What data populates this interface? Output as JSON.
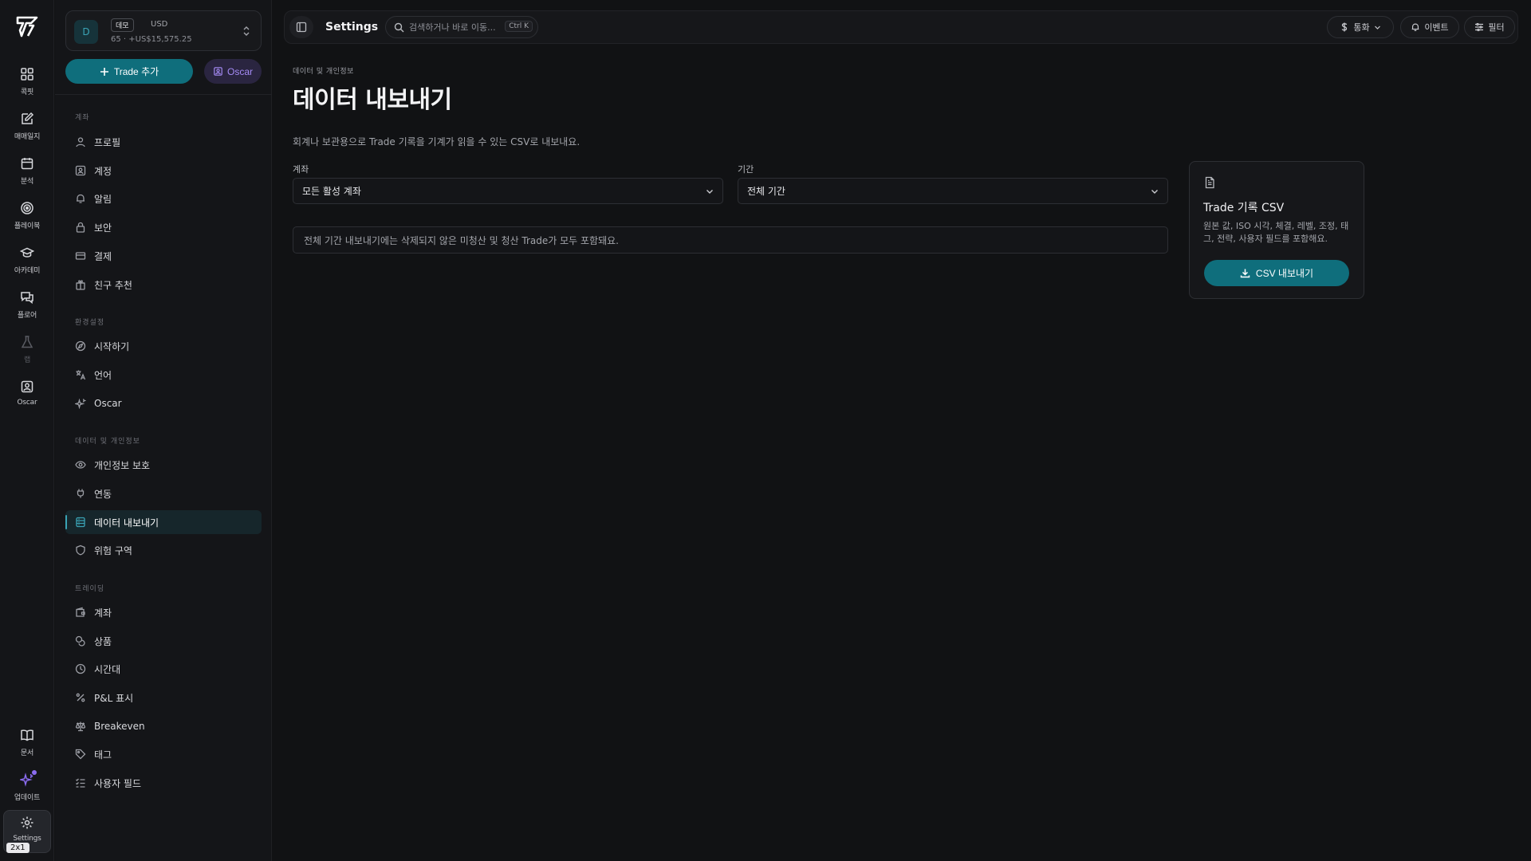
{
  "rail": {
    "items": [
      {
        "label": "콕핏",
        "icon": "dashboard-icon"
      },
      {
        "label": "매매일지",
        "icon": "journal-icon"
      },
      {
        "label": "분석",
        "icon": "calendar-icon"
      },
      {
        "label": "플레이북",
        "icon": "target-icon"
      },
      {
        "label": "아카데미",
        "icon": "graduation-cap-icon"
      },
      {
        "label": "플로어",
        "icon": "chat-icon"
      },
      {
        "label": "랩",
        "icon": "flask-icon"
      },
      {
        "label": "Oscar",
        "icon": "oscar-icon"
      }
    ],
    "bottom": [
      {
        "label": "문서",
        "icon": "book-icon"
      },
      {
        "label": "업데이트",
        "icon": "sparkle-icon"
      },
      {
        "label": "Settings",
        "icon": "gear-icon"
      }
    ],
    "shortcut_badge": "2x1"
  },
  "account": {
    "avatar_letter": "D",
    "badge": "데모",
    "currency": "USD",
    "summary": "65 · +US$15,575.25"
  },
  "actions": {
    "add_trade": "Trade 추가",
    "oscar": "Oscar"
  },
  "sidebar": {
    "sections": [
      {
        "title": "계좌",
        "items": [
          {
            "label": "프로필",
            "icon": "user-icon"
          },
          {
            "label": "계정",
            "icon": "id-card-icon"
          },
          {
            "label": "알림",
            "icon": "bell-icon"
          },
          {
            "label": "보안",
            "icon": "lock-icon"
          },
          {
            "label": "결제",
            "icon": "credit-card-icon"
          },
          {
            "label": "친구 추천",
            "icon": "gift-icon"
          }
        ]
      },
      {
        "title": "환경설정",
        "items": [
          {
            "label": "시작하기",
            "icon": "compass-icon"
          },
          {
            "label": "언어",
            "icon": "translate-icon"
          },
          {
            "label": "Oscar",
            "icon": "sparkles-icon"
          }
        ]
      },
      {
        "title": "데이터 및 개인정보",
        "items": [
          {
            "label": "개인정보 보호",
            "icon": "eye-icon"
          },
          {
            "label": "연동",
            "icon": "plug-icon"
          },
          {
            "label": "데이터 내보내기",
            "icon": "database-icon",
            "active": true
          },
          {
            "label": "위험 구역",
            "icon": "shield-icon"
          }
        ]
      },
      {
        "title": "트레이딩",
        "items": [
          {
            "label": "계좌",
            "icon": "wallet-icon"
          },
          {
            "label": "상품",
            "icon": "coins-icon"
          },
          {
            "label": "시간대",
            "icon": "clock-icon"
          },
          {
            "label": "P&L 표시",
            "icon": "percent-icon"
          },
          {
            "label": "Breakeven",
            "icon": "scale-icon"
          },
          {
            "label": "태그",
            "icon": "tag-icon"
          },
          {
            "label": "사용자 필드",
            "icon": "list-check-icon"
          }
        ]
      }
    ]
  },
  "topbar": {
    "title": "Settings",
    "search_placeholder": "검색하거나 바로 이동...",
    "search_shortcut": "Ctrl K",
    "currency_btn": "통화",
    "events_btn": "이벤트",
    "filter_btn": "필터"
  },
  "page": {
    "breadcrumb": "데이터 및 개인정보",
    "title": "데이터 내보내기",
    "description": "회계나 보관용으로 Trade 기록을 기계가 읽을 수 있는 CSV로 내보내요.",
    "account_label": "계좌",
    "account_value": "모든 활성 계좌",
    "period_label": "기간",
    "period_value": "전체 기간",
    "notice": "전체 기간 내보내기에는 삭제되지 않은 미청산 및 청산 Trade가 모두 포함돼요.",
    "card": {
      "title": "Trade 기록 CSV",
      "description": "원본 값, ISO 시각, 체결, 레벨, 조정, 태그, 전략, 사용자 필드를 포함해요.",
      "button": "CSV 내보내기"
    }
  },
  "colors": {
    "accent": "#0f6e7c",
    "accent_text": "#3aa3b5",
    "oscar": "#a58bf5",
    "bg": "#111214"
  }
}
